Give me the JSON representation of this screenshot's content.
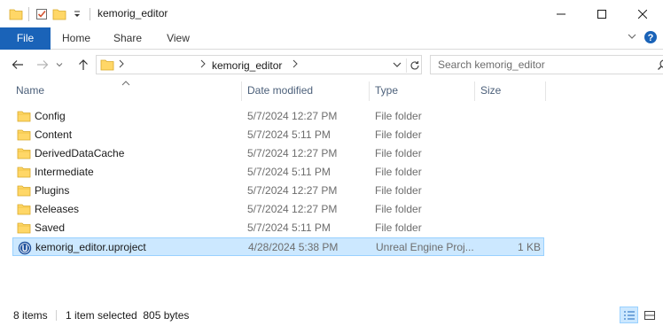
{
  "window": {
    "title": "kemorig_editor"
  },
  "ribbon": {
    "tabs": [
      "File",
      "Home",
      "Share",
      "View"
    ]
  },
  "address": {
    "crumb": "kemorig_editor",
    "search_placeholder": "Search kemorig_editor"
  },
  "columns": {
    "name": "Name",
    "date": "Date modified",
    "type": "Type",
    "size": "Size"
  },
  "files": [
    {
      "name": "Config",
      "date": "5/7/2024 12:27 PM",
      "type": "File folder",
      "size": "",
      "icon": "folder-icon",
      "selected": false
    },
    {
      "name": "Content",
      "date": "5/7/2024 5:11 PM",
      "type": "File folder",
      "size": "",
      "icon": "folder-icon",
      "selected": false
    },
    {
      "name": "DerivedDataCache",
      "date": "5/7/2024 12:27 PM",
      "type": "File folder",
      "size": "",
      "icon": "folder-icon",
      "selected": false
    },
    {
      "name": "Intermediate",
      "date": "5/7/2024 5:11 PM",
      "type": "File folder",
      "size": "",
      "icon": "folder-icon",
      "selected": false
    },
    {
      "name": "Plugins",
      "date": "5/7/2024 12:27 PM",
      "type": "File folder",
      "size": "",
      "icon": "folder-icon",
      "selected": false
    },
    {
      "name": "Releases",
      "date": "5/7/2024 12:27 PM",
      "type": "File folder",
      "size": "",
      "icon": "folder-icon",
      "selected": false
    },
    {
      "name": "Saved",
      "date": "5/7/2024 5:11 PM",
      "type": "File folder",
      "size": "",
      "icon": "folder-icon",
      "selected": false
    },
    {
      "name": "kemorig_editor.uproject",
      "date": "4/28/2024 5:38 PM",
      "type": "Unreal Engine Proj...",
      "size": "1 KB",
      "icon": "unreal-project-icon",
      "selected": true
    }
  ],
  "status": {
    "count": "8 items",
    "selection": "1 item selected  805 bytes"
  },
  "colors": {
    "accent": "#1a63b8",
    "selection_bg": "#cce8ff",
    "selection_border": "#99d1ff",
    "folder": "#ffd767",
    "header_text": "#4c607a"
  }
}
